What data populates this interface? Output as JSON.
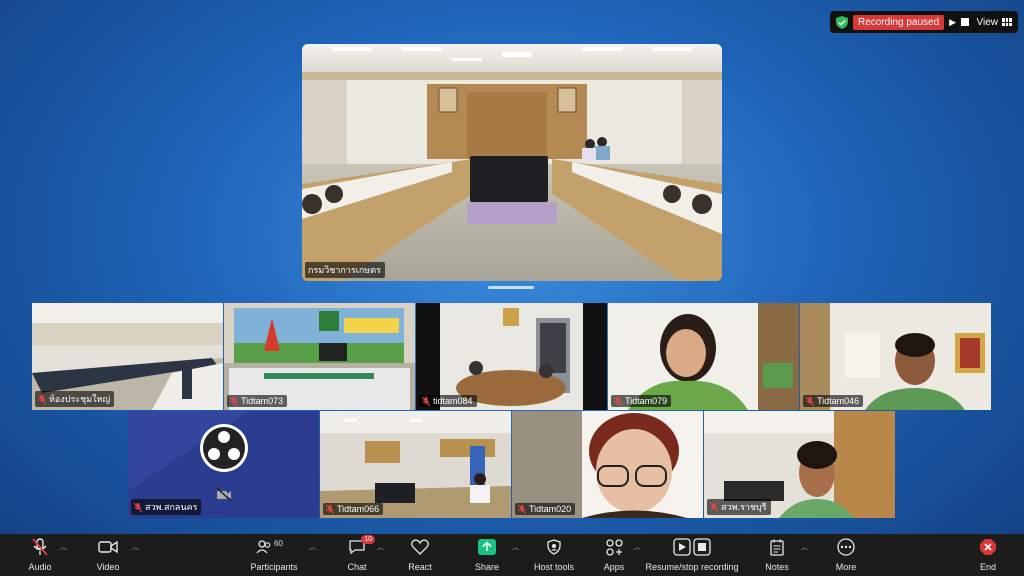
{
  "recording": {
    "status": "Recording paused",
    "view_label": "View"
  },
  "main_video": {
    "label": "กรมวิชาการเกษตร"
  },
  "tiles": [
    {
      "label": "ห้องประชุมใหญ่"
    },
    {
      "label": "Tidtam073"
    },
    {
      "label": "tidtam084"
    },
    {
      "label": "Tidtam079"
    },
    {
      "label": "Tidtam046"
    },
    {
      "label": "สวพ.สกลนคร"
    },
    {
      "label": "Tidtam066"
    },
    {
      "label": "Tidtam020"
    },
    {
      "label": "สวพ.ราชบุรี"
    }
  ],
  "toolbar": {
    "audio": "Audio",
    "video": "Video",
    "participants": "Participants",
    "participants_count": "60",
    "chat": "Chat",
    "chat_badge": "10",
    "react": "React",
    "share": "Share",
    "host_tools": "Host tools",
    "apps": "Apps",
    "recording": "Resume/stop recording",
    "notes": "Notes",
    "more": "More",
    "end": "End"
  },
  "colors": {
    "share_green": "#19c37d",
    "alert_red": "#d93838",
    "toolbar_bg": "#1c1c1c"
  }
}
